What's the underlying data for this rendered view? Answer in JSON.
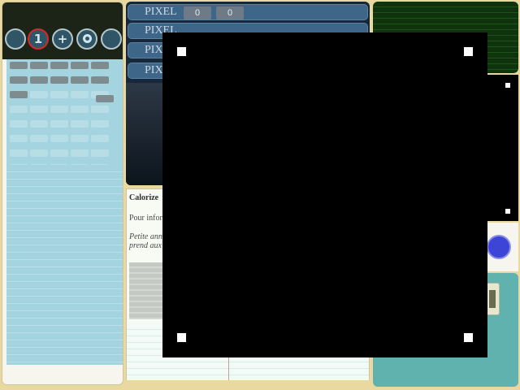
{
  "tools": {
    "buttons": [
      {
        "icon": "circle-blank-icon",
        "glyph": ""
      },
      {
        "icon": "number-one-icon",
        "glyph": "1",
        "active": true
      },
      {
        "icon": "plus-icon",
        "glyph": "+"
      },
      {
        "icon": "target-icon",
        "glyph": ""
      },
      {
        "icon": "circle-blank-icon",
        "glyph": ""
      }
    ],
    "active_color": "#d52a2a"
  },
  "pixel_rows": [
    {
      "label": "PIXEL",
      "value1": "0",
      "value2": "0"
    },
    {
      "label": "PIXEL",
      "value1": "",
      "value2": ""
    },
    {
      "label": "PIXEL",
      "value1": "",
      "value2": ""
    },
    {
      "label": "PIXEL",
      "value1": "",
      "value2": ""
    }
  ],
  "doc": {
    "title": "Calorize",
    "line1": "Pour inform",
    "line2": "Petite ann",
    "line3": "prend aux"
  },
  "colors": {
    "page_bg": "#e9d9a0",
    "palette_bg": "#a4d4e0",
    "accent_blue": "#3d45d6",
    "overlay": "#000000"
  }
}
